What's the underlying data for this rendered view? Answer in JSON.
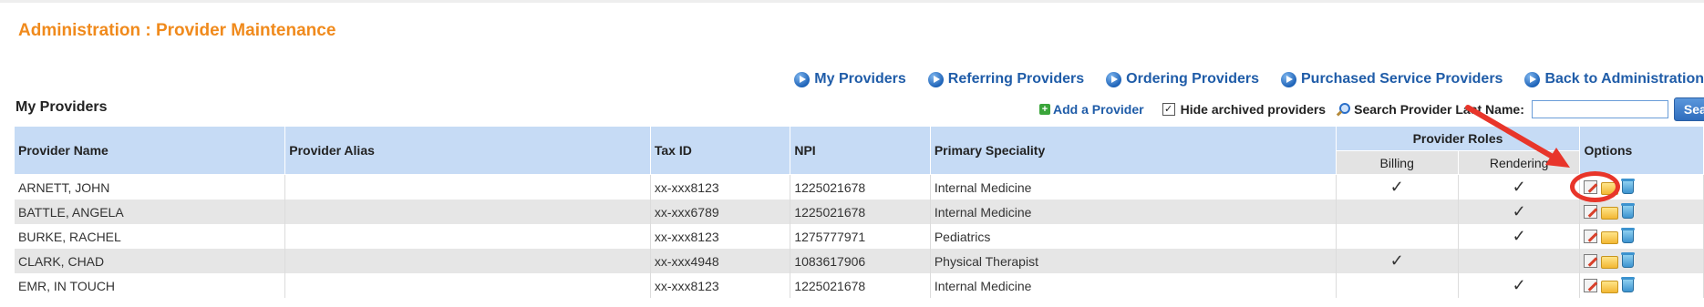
{
  "page_title": "Administration : Provider Maintenance",
  "nav_links": [
    "My Providers",
    "Referring Providers",
    "Ordering Providers",
    "Purchased Service Providers",
    "Back to Administration"
  ],
  "section_title": "My Providers",
  "toolbar": {
    "add_provider": "Add a Provider",
    "hide_archived": "Hide archived providers",
    "hide_archived_checked": true,
    "search_label": "Search Provider Last Name:",
    "search_value": "",
    "search_button": "Searc"
  },
  "table": {
    "headers": {
      "name": "Provider Name",
      "alias": "Provider Alias",
      "tax": "Tax ID",
      "npi": "NPI",
      "speciality": "Primary Speciality",
      "roles": "Provider Roles",
      "billing": "Billing",
      "rendering": "Rendering",
      "options": "Options"
    },
    "rows": [
      {
        "name": "ARNETT, JOHN",
        "alias": "",
        "tax": "xx-xxx8123",
        "npi": "1225021678",
        "speciality": "Internal Medicine",
        "billing": true,
        "rendering": true
      },
      {
        "name": "BATTLE, ANGELA",
        "alias": "",
        "tax": "xx-xxx6789",
        "npi": "1225021678",
        "speciality": "Internal Medicine",
        "billing": false,
        "rendering": true
      },
      {
        "name": "BURKE, RACHEL",
        "alias": "",
        "tax": "xx-xxx8123",
        "npi": "1275777971",
        "speciality": "Pediatrics",
        "billing": false,
        "rendering": true
      },
      {
        "name": "CLARK, CHAD",
        "alias": "",
        "tax": "xx-xxx4948",
        "npi": "1083617906",
        "speciality": "Physical Therapist",
        "billing": true,
        "rendering": false
      },
      {
        "name": "EMR, IN TOUCH",
        "alias": "",
        "tax": "xx-xxx8123",
        "npi": "1225021678",
        "speciality": "Internal Medicine",
        "billing": false,
        "rendering": true
      }
    ]
  },
  "check_glyph": "✓",
  "colors": {
    "title": "#f08a1c",
    "link": "#1f5ca8",
    "header": "#c6dbf5",
    "check": "#2e9a2e",
    "annotation": "#e8352a"
  }
}
